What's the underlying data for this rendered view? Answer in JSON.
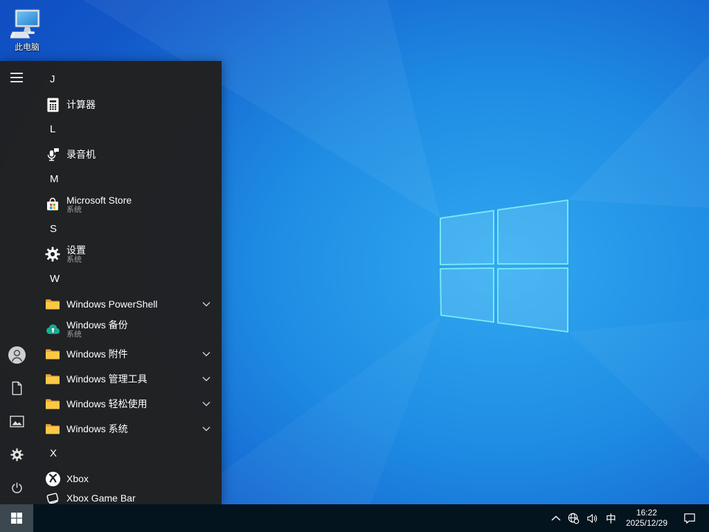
{
  "desktop": {
    "this_pc": {
      "label": "此电脑",
      "icon": "computer-icon"
    }
  },
  "start_menu": {
    "rows": [
      {
        "type": "section-letter",
        "label": "J"
      },
      {
        "type": "app",
        "label": "计算器",
        "icon": "calculator-icon"
      },
      {
        "type": "section-letter",
        "label": "L"
      },
      {
        "type": "app",
        "label": "录音机",
        "icon": "microphone-icon"
      },
      {
        "type": "section-letter",
        "label": "M"
      },
      {
        "type": "app",
        "label": "Microsoft Store",
        "sublabel": "系统",
        "icon": "store-icon"
      },
      {
        "type": "section-letter",
        "label": "S"
      },
      {
        "type": "app",
        "label": "设置",
        "sublabel": "系统",
        "icon": "gear-icon"
      },
      {
        "type": "section-letter",
        "label": "W"
      },
      {
        "type": "folder-group",
        "label": "Windows PowerShell",
        "icon": "folder-icon",
        "expandable": true
      },
      {
        "type": "app",
        "label": "Windows 备份",
        "sublabel": "系统",
        "icon": "cloud-backup-icon"
      },
      {
        "type": "folder-group",
        "label": "Windows 附件",
        "icon": "folder-icon",
        "expandable": true
      },
      {
        "type": "folder-group",
        "label": "Windows 管理工具",
        "icon": "folder-icon",
        "expandable": true
      },
      {
        "type": "folder-group",
        "label": "Windows 轻松使用",
        "icon": "folder-icon",
        "expandable": true
      },
      {
        "type": "folder-group",
        "label": "Windows 系统",
        "icon": "folder-icon",
        "expandable": true
      },
      {
        "type": "section-letter",
        "label": "X"
      },
      {
        "type": "app",
        "label": "Xbox",
        "icon": "xbox-icon"
      },
      {
        "type": "app",
        "label": "Xbox Game Bar",
        "icon": "xbox-gamebar-icon"
      }
    ],
    "rail_icons": [
      "hamburger-icon",
      "user-icon",
      "document-icon",
      "pictures-icon",
      "gear-icon",
      "power-icon"
    ]
  },
  "taskbar": {
    "start_icon": "windows-logo-icon",
    "tray": {
      "icons": [
        "chevron-up-icon",
        "globe-no-internet-icon",
        "speaker-icon",
        "ime-indicator",
        "clock",
        "action-center-icon"
      ],
      "ime": "中",
      "time": "16:22",
      "date": "2025/12/29"
    }
  },
  "colors": {
    "wallpaper_center": "#31a8f0",
    "wallpaper_edge": "#0f4cc0",
    "logo_border": "#7eeef7",
    "menu_bg": "#212121",
    "taskbar_bg": "#04141f",
    "start_button_bg": "#3b4850",
    "ms_red": "#f25022",
    "ms_green": "#7fba00",
    "ms_blue": "#00a4ef",
    "ms_yellow": "#ffb900",
    "folder_yellow": "#fdc944",
    "cloud_teal": "#16b095"
  }
}
